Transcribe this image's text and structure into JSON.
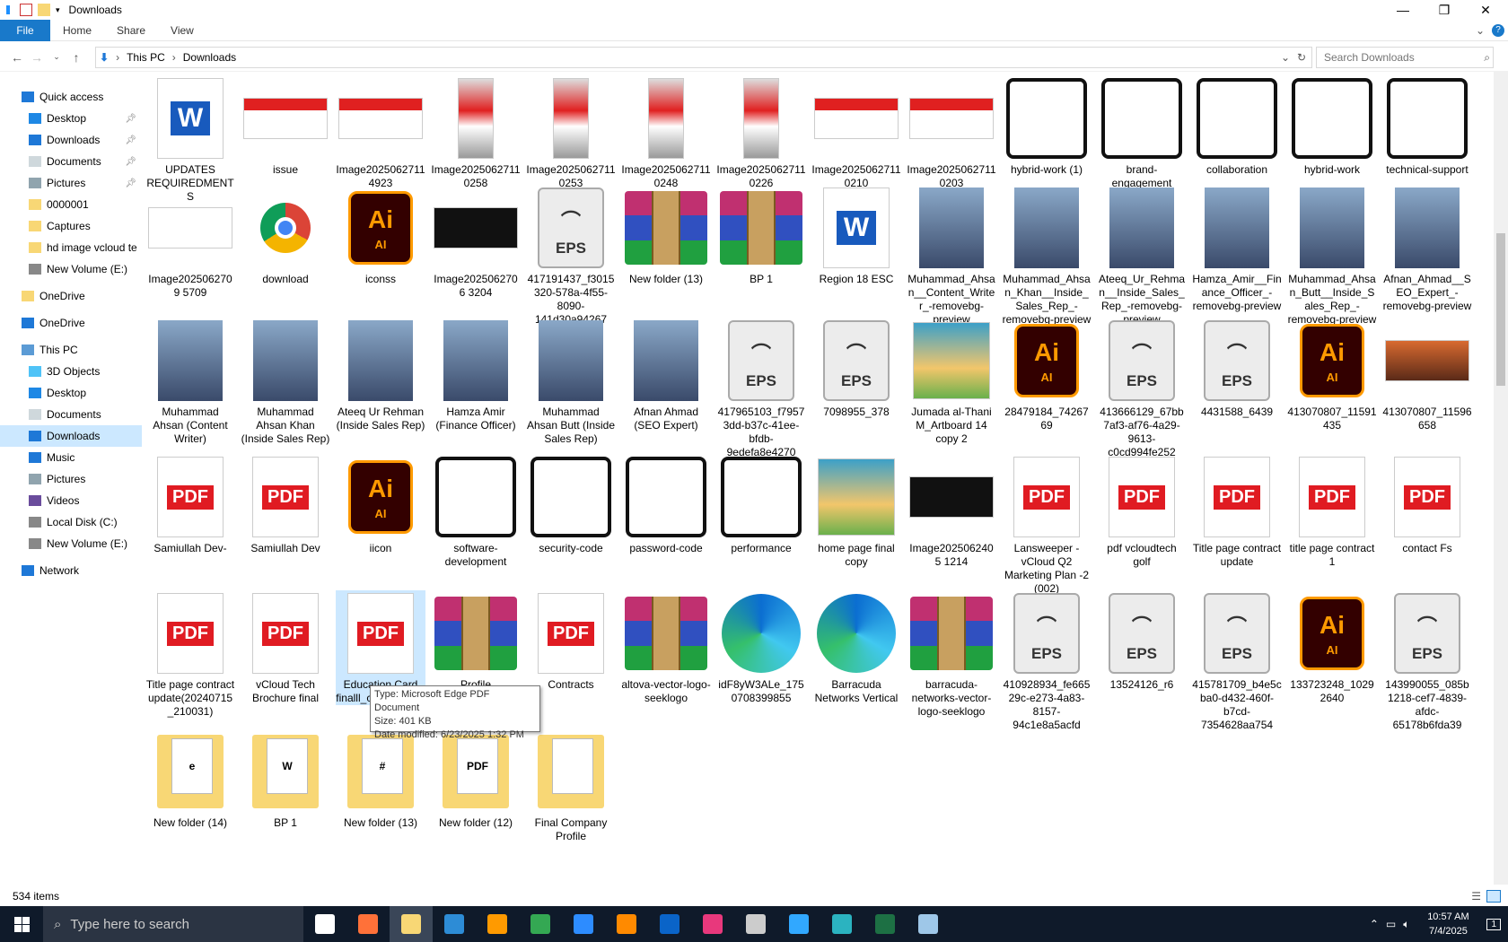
{
  "window": {
    "title": "Downloads"
  },
  "ribbon": {
    "file": "File",
    "tabs": [
      "Home",
      "Share",
      "View"
    ]
  },
  "address": {
    "path": [
      "This PC",
      "Downloads"
    ],
    "search_placeholder": "Search Downloads"
  },
  "sidebar": {
    "items": [
      {
        "label": "Quick access",
        "level": 0,
        "icon": "star-icon",
        "pinned": false
      },
      {
        "label": "Desktop",
        "level": 1,
        "icon": "desktop-icon",
        "pinned": true
      },
      {
        "label": "Downloads",
        "level": 1,
        "icon": "download-arrow-icon",
        "pinned": true
      },
      {
        "label": "Documents",
        "level": 1,
        "icon": "documents-icon",
        "pinned": true
      },
      {
        "label": "Pictures",
        "level": 1,
        "icon": "pictures-icon",
        "pinned": true
      },
      {
        "label": "0000001",
        "level": 1,
        "icon": "folder-icon",
        "pinned": false
      },
      {
        "label": "Captures",
        "level": 1,
        "icon": "folder-icon",
        "pinned": false
      },
      {
        "label": "hd image vcloud te",
        "level": 1,
        "icon": "folder-icon",
        "pinned": false
      },
      {
        "label": "New Volume (E:)",
        "level": 1,
        "icon": "drive-icon",
        "pinned": false
      },
      {
        "label": "OneDrive",
        "level": 0,
        "icon": "folder-icon",
        "pinned": false
      },
      {
        "label": "OneDrive",
        "level": 0,
        "icon": "cloud-icon",
        "pinned": false
      },
      {
        "label": "This PC",
        "level": 0,
        "icon": "computer-icon",
        "pinned": false
      },
      {
        "label": "3D Objects",
        "level": 1,
        "icon": "cube-icon",
        "pinned": false
      },
      {
        "label": "Desktop",
        "level": 1,
        "icon": "desktop-icon",
        "pinned": false
      },
      {
        "label": "Documents",
        "level": 1,
        "icon": "documents-icon",
        "pinned": false
      },
      {
        "label": "Downloads",
        "level": 1,
        "icon": "download-arrow-icon",
        "pinned": false,
        "selected": true
      },
      {
        "label": "Music",
        "level": 1,
        "icon": "music-icon",
        "pinned": false
      },
      {
        "label": "Pictures",
        "level": 1,
        "icon": "pictures-icon",
        "pinned": false
      },
      {
        "label": "Videos",
        "level": 1,
        "icon": "video-icon",
        "pinned": false
      },
      {
        "label": "Local Disk (C:)",
        "level": 1,
        "icon": "drive-icon",
        "pinned": false
      },
      {
        "label": "New Volume (E:)",
        "level": 1,
        "icon": "drive-icon",
        "pinned": false
      },
      {
        "label": "Network",
        "level": 0,
        "icon": "network-icon",
        "pinned": false
      }
    ]
  },
  "files": [
    [
      {
        "name": "UPDATES REQUIREDMENTS",
        "kind": "word"
      },
      {
        "name": "issue",
        "kind": "image-red"
      },
      {
        "name": "Image20250627114923",
        "kind": "image-red"
      },
      {
        "name": "Image20250627110258",
        "kind": "image-tall"
      },
      {
        "name": "Image20250627110253",
        "kind": "image-tall"
      },
      {
        "name": "Image20250627110248",
        "kind": "image-tall"
      },
      {
        "name": "Image20250627110226",
        "kind": "image-tall"
      },
      {
        "name": "Image20250627110210",
        "kind": "image-red"
      },
      {
        "name": "Image20250627110203",
        "kind": "image-red"
      },
      {
        "name": "hybrid-work (1)",
        "kind": "line-icon"
      },
      {
        "name": "brand-engagement",
        "kind": "line-icon"
      },
      {
        "name": "collaboration",
        "kind": "line-icon"
      },
      {
        "name": "hybrid-work",
        "kind": "line-icon"
      },
      {
        "name": "technical-support",
        "kind": "line-icon"
      }
    ],
    [
      {
        "name": "Image2025062709 5709",
        "kind": "image-white"
      },
      {
        "name": "download",
        "kind": "chrome"
      },
      {
        "name": "iconss",
        "kind": "ai"
      },
      {
        "name": "Image2025062706 3204",
        "kind": "image-dark"
      },
      {
        "name": "417191437_f3015320-578a-4f55-8090-141d30a94267",
        "kind": "eps"
      },
      {
        "name": "New folder (13)",
        "kind": "rar"
      },
      {
        "name": "BP 1",
        "kind": "rar"
      },
      {
        "name": "Region 18 ESC",
        "kind": "word"
      },
      {
        "name": "Muhammad_Ahsan__Content_Writer_-removebg-preview",
        "kind": "photo"
      },
      {
        "name": "Muhammad_Ahsan_Khan__Inside_Sales_Rep_-removebg-preview",
        "kind": "photo"
      },
      {
        "name": "Ateeq_Ur_Rehman__Inside_Sales_Rep_-removebg-preview",
        "kind": "photo"
      },
      {
        "name": "Hamza_Amir__Finance_Officer_-removebg-preview",
        "kind": "photo"
      },
      {
        "name": "Muhammad_Ahsan_Butt__Inside_Sales_Rep_-removebg-preview",
        "kind": "photo"
      },
      {
        "name": "Afnan_Ahmad__SEO_Expert_-removebg-preview",
        "kind": "photo"
      }
    ],
    [
      {
        "name": "Muhammad Ahsan (Content Writer)",
        "kind": "photo"
      },
      {
        "name": "Muhammad Ahsan Khan (Inside Sales Rep)",
        "kind": "photo"
      },
      {
        "name": "Ateeq Ur Rehman (Inside Sales Rep)",
        "kind": "photo"
      },
      {
        "name": "Hamza Amir (Finance Officer)",
        "kind": "photo"
      },
      {
        "name": "Muhammad Ahsan Butt (Inside Sales Rep)",
        "kind": "photo"
      },
      {
        "name": "Afnan Ahmad (SEO Expert)",
        "kind": "photo"
      },
      {
        "name": "417965103_f79573dd-b37c-41ee-bfdb-9edefa8e4270",
        "kind": "eps"
      },
      {
        "name": "7098955_378",
        "kind": "eps"
      },
      {
        "name": "Jumada al-Thani M_Artboard 14 copy 2",
        "kind": "image-poster"
      },
      {
        "name": "28479184_7426769",
        "kind": "ai"
      },
      {
        "name": "413666129_67bb7af3-af76-4a29-9613-c0cd994fe252",
        "kind": "eps"
      },
      {
        "name": "4431588_6439",
        "kind": "eps"
      },
      {
        "name": "413070807_11591435",
        "kind": "ai"
      },
      {
        "name": "413070807_11596658",
        "kind": "image-orange"
      }
    ],
    [
      {
        "name": "Samiullah Dev-",
        "kind": "pdf"
      },
      {
        "name": "Samiullah Dev",
        "kind": "pdf"
      },
      {
        "name": "iicon",
        "kind": "ai"
      },
      {
        "name": "software-development",
        "kind": "line-icon"
      },
      {
        "name": "security-code",
        "kind": "line-icon"
      },
      {
        "name": "password-code",
        "kind": "line-icon"
      },
      {
        "name": "performance",
        "kind": "line-icon"
      },
      {
        "name": "home page final copy",
        "kind": "image-poster"
      },
      {
        "name": "Image2025062405 1214",
        "kind": "image-dark"
      },
      {
        "name": "Lansweeper - vCloud Q2 Marketing Plan -2 (002)",
        "kind": "pdf"
      },
      {
        "name": "pdf vcloudtech golf",
        "kind": "pdf"
      },
      {
        "name": "Title page contract  update",
        "kind": "pdf"
      },
      {
        "name": "title page contract 1",
        "kind": "pdf"
      },
      {
        "name": "contact Fs",
        "kind": "pdf"
      }
    ],
    [
      {
        "name": "Title page contract update(20240715_210031)",
        "kind": "pdf"
      },
      {
        "name": "vCloud Tech Brochure final",
        "kind": "pdf"
      },
      {
        "name": "Education Card finalll_compressed",
        "kind": "pdf",
        "selected": true
      },
      {
        "name": "Profile",
        "kind": "rar"
      },
      {
        "name": "Contracts",
        "kind": "pdf"
      },
      {
        "name": "altova-vector-logo-seeklogo",
        "kind": "rar"
      },
      {
        "name": "idF8yW3ALe_1750708399855",
        "kind": "edge"
      },
      {
        "name": "Barracuda Networks Vertical",
        "kind": "edge"
      },
      {
        "name": "barracuda-networks-vector-logo-seeklogo",
        "kind": "rar"
      },
      {
        "name": "410928934_fe66529c-e273-4a83-8157-94c1e8a5acfd",
        "kind": "eps"
      },
      {
        "name": "13524126_r6",
        "kind": "eps"
      },
      {
        "name": "415781709_b4e5cba0-d432-460f-b7cd-7354628aa754",
        "kind": "eps"
      },
      {
        "name": "133723248_10292640",
        "kind": "ai"
      },
      {
        "name": "143990055_085b1218-cef7-4839-afdc-65178b6fda39",
        "kind": "eps"
      }
    ],
    [
      {
        "name": "New folder (14)",
        "kind": "folder",
        "glyph": "e"
      },
      {
        "name": "BP 1",
        "kind": "folder",
        "glyph": "W"
      },
      {
        "name": "New folder (13)",
        "kind": "folder",
        "glyph": "#"
      },
      {
        "name": "New folder (12)",
        "kind": "folder",
        "glyph": "PDF"
      },
      {
        "name": "Final Company Profile",
        "kind": "folder",
        "glyph": ""
      }
    ]
  ],
  "tooltip": {
    "type": "Type: Microsoft Edge PDF Document",
    "size": "Size: 401 KB",
    "modified": "Date modified: 6/23/2025 1:32 PM"
  },
  "status": {
    "count": "534 items"
  },
  "taskbar": {
    "search_placeholder": "Type here to search",
    "apps": [
      "task-view-icon",
      "firefox-icon",
      "file-explorer-icon",
      "vscode-icon",
      "illustrator-icon",
      "chrome-icon",
      "zoom-icon",
      "sublime-icon",
      "outlook-icon",
      "creative-cloud-icon",
      "pen-tool-icon",
      "photoshop-icon",
      "app-icon",
      "excel-icon",
      "notepad-icon"
    ],
    "time": "10:57 AM",
    "date": "7/4/2025",
    "notification_count": "1"
  },
  "colors": {
    "accent": "#1979ca",
    "selection": "#cce8ff",
    "pdf": "#e01b22",
    "ai_orange": "#ff9a00",
    "taskbar": "#0f1a2a"
  }
}
